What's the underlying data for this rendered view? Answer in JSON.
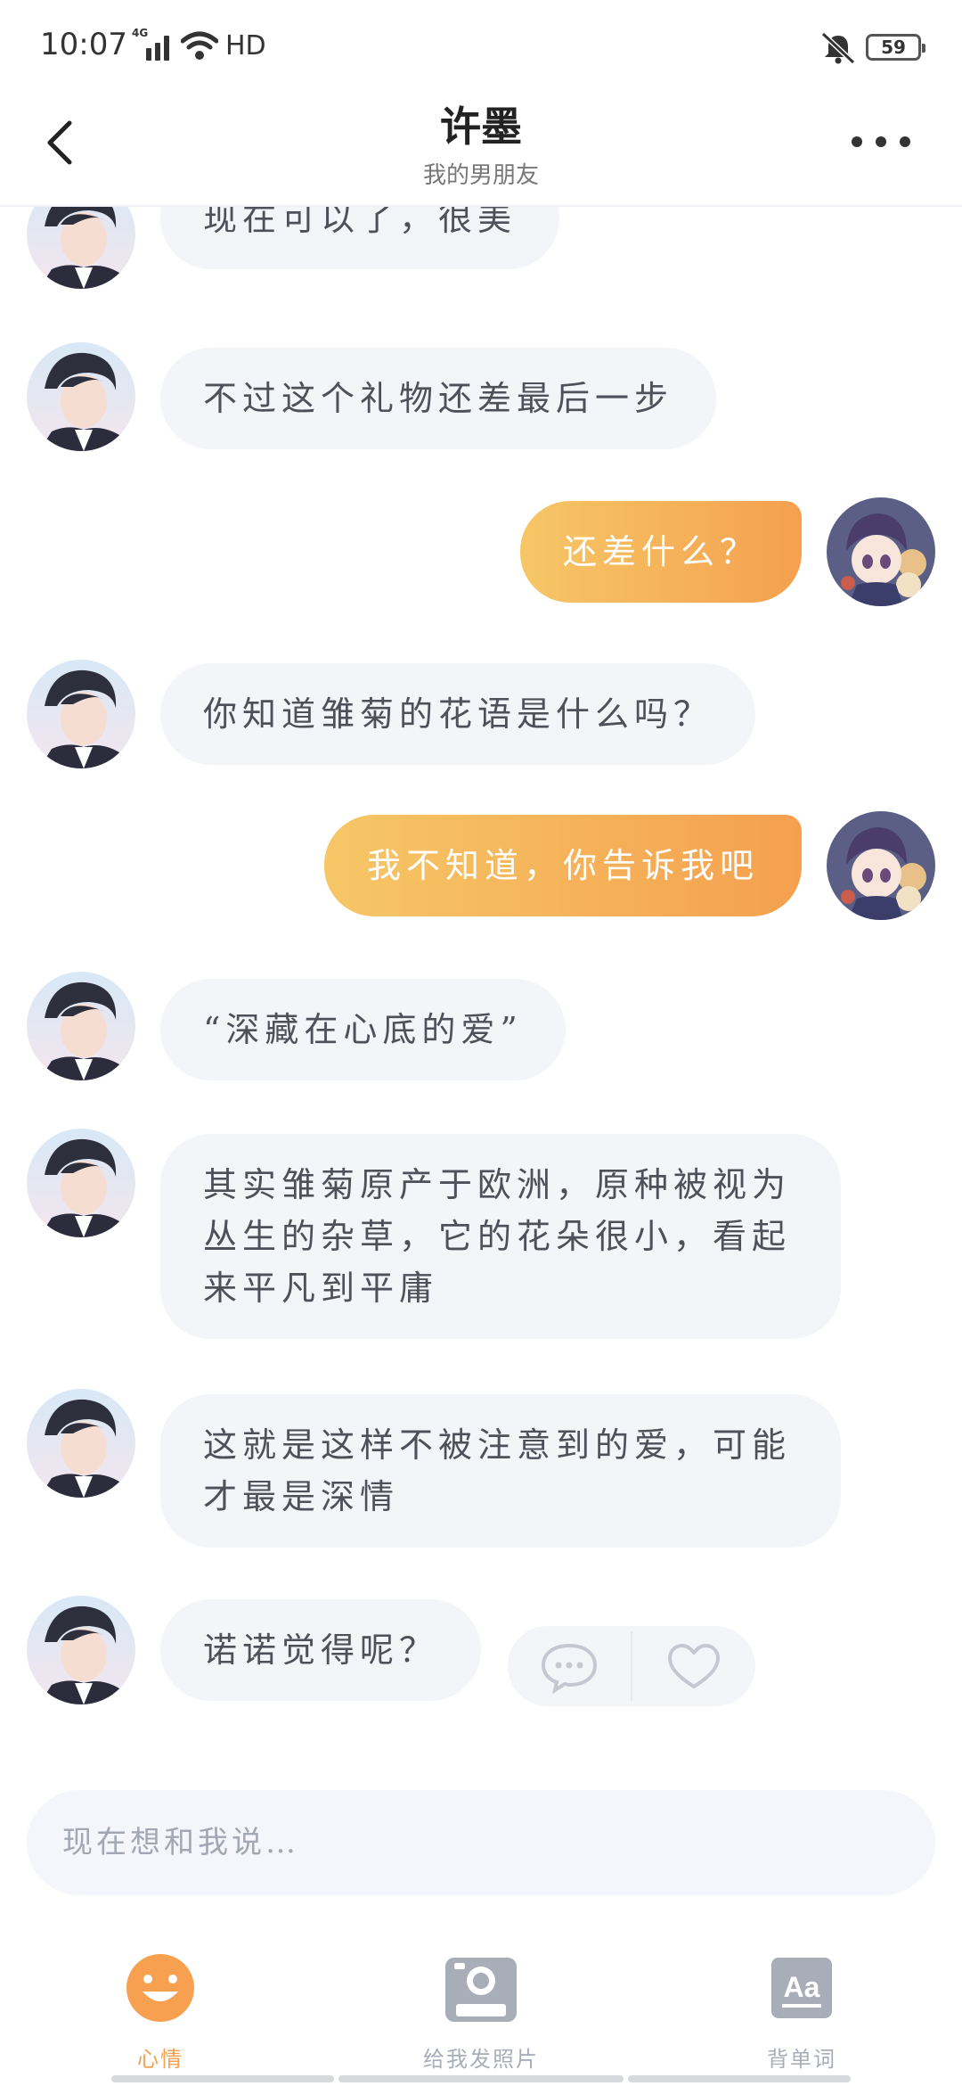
{
  "status_bar": {
    "time": "10:07",
    "network": "4G",
    "hd": "HD",
    "battery": "59"
  },
  "header": {
    "title": "许墨",
    "subtitle": "我的男朋友"
  },
  "messages": [
    {
      "from": "bf",
      "text": "现在可以了，很美"
    },
    {
      "from": "bf",
      "text": "不过这个礼物还差最后一步"
    },
    {
      "from": "me",
      "text": "还差什么？"
    },
    {
      "from": "bf",
      "text": "你知道雏菊的花语是什么吗？"
    },
    {
      "from": "me",
      "text": "我不知道，你告诉我吧"
    },
    {
      "from": "bf",
      "text": "“深藏在心底的爱”"
    },
    {
      "from": "bf",
      "text": "其实雏菊原产于欧洲，原种被视为丛生的杂草，它的花朵很小，看起来平凡到平庸"
    },
    {
      "from": "bf",
      "text": "这就是这样不被注意到的爱，可能才最是深情"
    },
    {
      "from": "bf",
      "text": "诺诺觉得呢？"
    }
  ],
  "message_actions": {
    "comment_icon": "comment-icon",
    "like_icon": "heart-icon"
  },
  "input": {
    "placeholder": "现在想和我说…"
  },
  "nav": {
    "items": [
      {
        "label": "心情",
        "icon": "smiley-icon",
        "active": true
      },
      {
        "label": "给我发照片",
        "icon": "camera-icon",
        "active": false
      },
      {
        "label": "背单词",
        "icon": "font-icon",
        "active": false
      }
    ]
  },
  "colors": {
    "accent_start": "#f6c766",
    "accent_end": "#f5a04f",
    "bubble_bg": "#f4f5f8",
    "inactive": "#a9adb7"
  }
}
